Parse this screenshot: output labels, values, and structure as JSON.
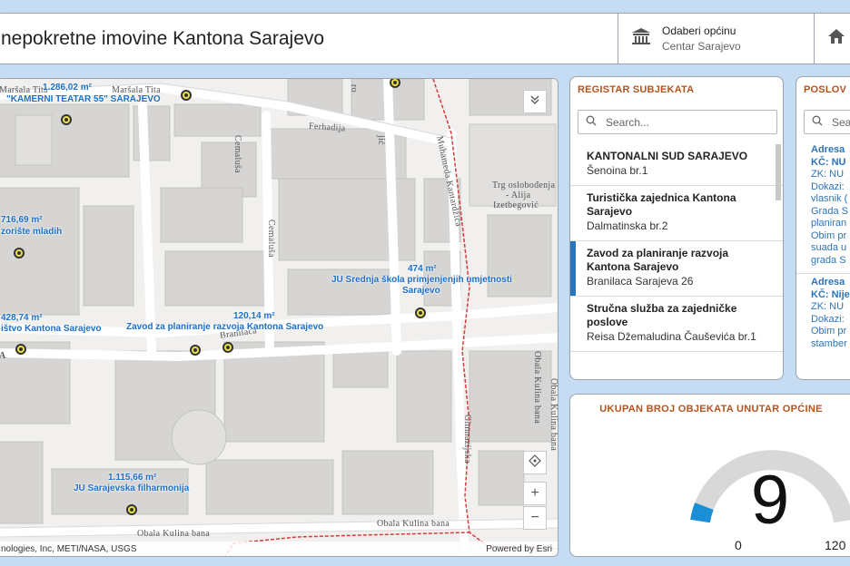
{
  "header": {
    "title": "nepokretne imovine Kantona Sarajevo",
    "selector1": {
      "label": "Odaberi općinu",
      "value": "Centar Sarajevo"
    }
  },
  "map": {
    "labels": {
      "l1": "1.286,02 m²",
      "l2": "\"KAMERNI TEATAR 55\" SARAJEVO",
      "l3": "716,69 m²",
      "l4": "zorište mladih",
      "l5": "474 m²",
      "l6": "JU Srednja škola primjenjenjih umjetnosti",
      "l7": "Sarajevo",
      "l8": "428,74 m²",
      "l9": "ištvo Kantona Sarajevo",
      "l10": "120,14 m²",
      "l11": "Zavod za planiranje razvoja Kantona Sarajevo",
      "l12": "1.115,66 m²",
      "l13": "JU Sarajevska filharmonija"
    },
    "streets": {
      "s1": "Maršala Tita",
      "s2": "Maršala Tita",
      "s3": "Ferhadija",
      "s4": "Cemaluša",
      "s5": "Cemaluša",
      "s6": "Muhameda Kantardžića",
      "s7": "Trg oslobođenja",
      "s8": "- Alija",
      "s9": "Izetbegović",
      "s10": "Branilaca",
      "s11": "Gimnazijska",
      "s12": "Obala Kulina bana",
      "s13": "Obala Kulina bana",
      "s14": "Obala Kulina bana",
      "s15": "Obala Kulina bana",
      "s16": "A",
      "s17": "ro",
      "s18": "jić"
    },
    "attribution_left": "nologies, Inc, METI/NASA, USGS",
    "attribution_right": "Powered by Esri",
    "zoom_in": "+",
    "zoom_out": "−"
  },
  "registry": {
    "title": "REGISTAR SUBJEKATA",
    "search_placeholder": "Search...",
    "items": [
      {
        "name": "KANTONALNI SUD SARAJEVO",
        "address": "Šenoina br.1"
      },
      {
        "name": "Turistička zajednica Kantona Sarajevo",
        "address": "Dalmatinska br.2"
      },
      {
        "name": "Zavod za planiranje razvoja Kantona Sarajevo",
        "address": "Branilaca Sarajeva 26"
      },
      {
        "name": "Stručna služba za zajedničke poslove",
        "address": "Reisa Džemaludina Čauševića br.1"
      }
    ]
  },
  "properties": {
    "title": "POSLOV",
    "search_placeholder": "Sea",
    "lines": [
      {
        "text": "Adresa",
        "bold": true
      },
      {
        "text": "KČ: NU",
        "bold": true
      },
      {
        "text": "ZK: NU",
        "bold": false
      },
      {
        "text": "Dokazi:",
        "bold": false
      },
      {
        "text": "vlasnik (",
        "bold": false
      },
      {
        "text": "Grada S",
        "bold": false
      },
      {
        "text": "planiran",
        "bold": false
      },
      {
        "text": "Obim pr",
        "bold": false
      },
      {
        "text": "suada u",
        "bold": false
      },
      {
        "text": "grada S",
        "bold": false
      },
      {
        "text": "",
        "bold": false
      },
      {
        "text": "Adresa",
        "bold": true
      },
      {
        "text": "KČ: Nije",
        "bold": true
      },
      {
        "text": "ZK: NU",
        "bold": false
      },
      {
        "text": "Dokazi:",
        "bold": false
      },
      {
        "text": "Obim pr",
        "bold": false
      },
      {
        "text": "stamber",
        "bold": false
      }
    ]
  },
  "gauge": {
    "title": "UKUPAN BROJ OBJEKATA UNUTAR OPĆINE",
    "value": 9,
    "value_text": "9",
    "min": "0",
    "max": "120",
    "min_value": 0,
    "max_value": 120,
    "fill_color": "#1a8fd6",
    "track_color": "#d8d8d8"
  }
}
